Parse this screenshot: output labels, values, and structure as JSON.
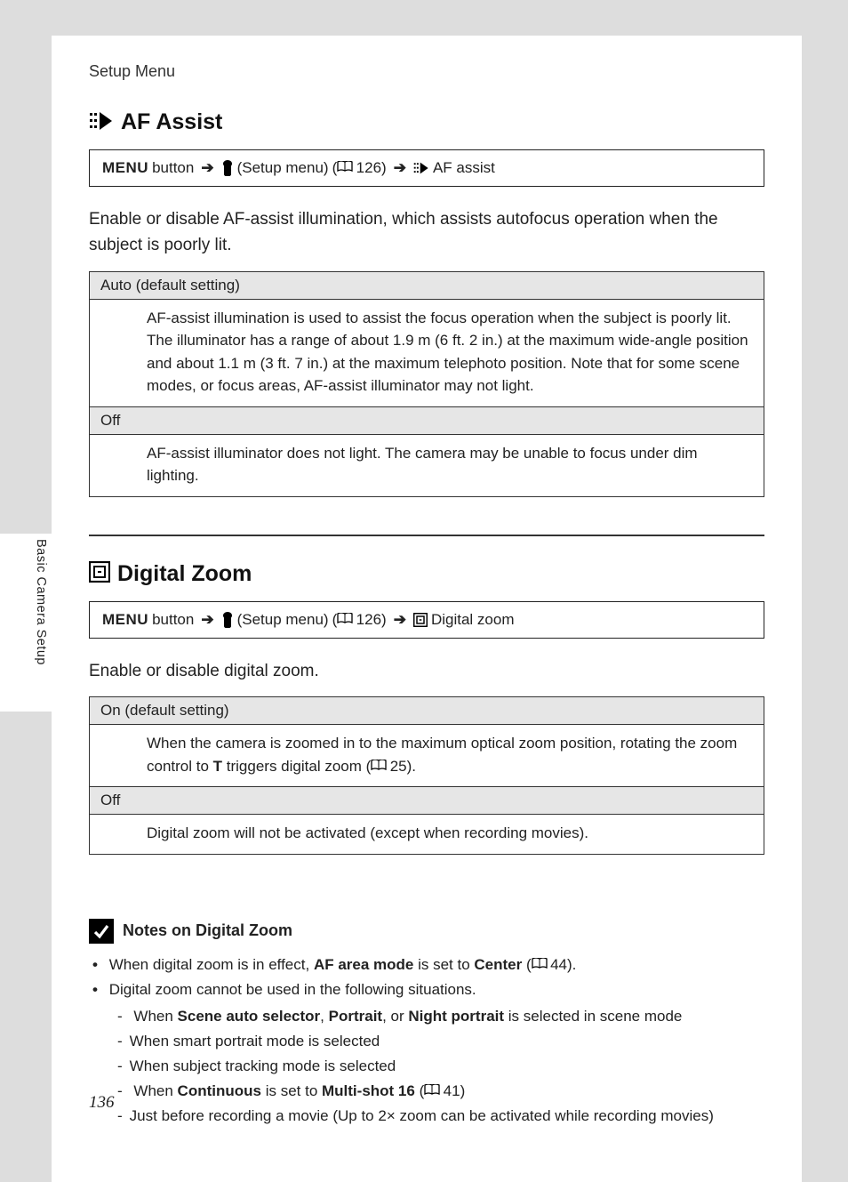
{
  "header": {
    "section_path": "Setup Menu"
  },
  "side_label": "Basic Camera Setup",
  "page_number": "136",
  "af_assist": {
    "title": "AF Assist",
    "path": {
      "menu_label": "MENU",
      "button_word": "button",
      "setup_label": "(Setup menu)",
      "ref": "126",
      "item_label": "AF assist"
    },
    "intro": "Enable or disable AF-assist illumination, which assists autofocus operation when the subject is poorly lit.",
    "options": [
      {
        "label": "Auto (default setting)",
        "description": "AF-assist illumination is used to assist the focus operation when the subject is poorly lit. The illuminator has a range of about 1.9 m (6 ft. 2 in.) at the maximum wide-angle position and about 1.1 m (3 ft. 7 in.) at the maximum telephoto position. Note that for some scene modes, or focus areas, AF-assist illuminator may not light."
      },
      {
        "label": "Off",
        "description": "AF-assist illuminator does not light. The camera may be unable to focus under dim lighting."
      }
    ]
  },
  "digital_zoom": {
    "title": "Digital Zoom",
    "path": {
      "menu_label": "MENU",
      "button_word": "button",
      "setup_label": "(Setup menu)",
      "ref": "126",
      "item_label": "Digital zoom"
    },
    "intro": "Enable or disable digital zoom.",
    "options": [
      {
        "label": "On (default setting)",
        "desc_pre": "When the camera is zoomed in to the maximum optical zoom position, rotating the zoom control to ",
        "t_label": "T",
        "desc_mid": " triggers digital zoom (",
        "ref": "25",
        "desc_post": ")."
      },
      {
        "label": "Off",
        "description": "Digital zoom will not be activated (except when recording movies)."
      }
    ]
  },
  "notes": {
    "title": "Notes on Digital Zoom",
    "bullet1": {
      "pre": "When digital zoom is in effect, ",
      "bold1": "AF area mode",
      "mid": " is set to ",
      "bold2": "Center",
      "ref": "44",
      "post": "."
    },
    "bullet2": {
      "text": "Digital zoom cannot be used in the following situations.",
      "sub": [
        {
          "pre": "When ",
          "b1": "Scene auto selector",
          "sep1": ", ",
          "b2": "Portrait",
          "sep2": ", or ",
          "b3": "Night portrait",
          "post": " is selected in scene mode"
        },
        {
          "text": "When smart portrait mode is selected"
        },
        {
          "text": "When subject tracking mode is selected"
        },
        {
          "pre": "When ",
          "b1": "Continuous",
          "mid": " is set to ",
          "b2": "Multi-shot 16",
          "ref": "41"
        },
        {
          "text": "Just before recording a movie (Up to 2× zoom can be activated while recording movies)"
        }
      ]
    }
  }
}
